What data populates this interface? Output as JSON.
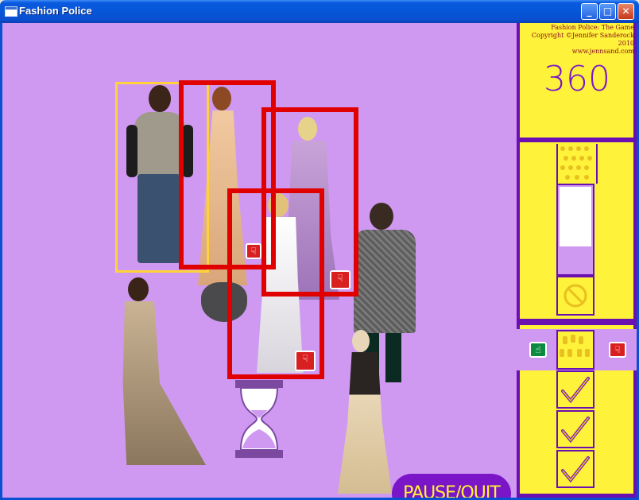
{
  "window": {
    "title": "Fashion Police",
    "icon": "window-app-icon",
    "buttons": {
      "minimize": "_",
      "maximize": "□",
      "close": "✕"
    }
  },
  "panel": {
    "credits": [
      "Fashion Police: The Game",
      "Copyright ©Jennifer Sanderock 2010",
      "www.jennsand.com"
    ],
    "score": "360",
    "queue_fill": 0.68,
    "row_rejected_icon": "no-symbol-icon",
    "approve_icon": "thumbs-up-icon",
    "reject_icon": "thumbs-down-icon",
    "checkmarks": 3
  },
  "game": {
    "pause_label": "PAUSE/QUIT",
    "hourglass_icon": "hourglass-icon",
    "colors": {
      "background": "#cf99f2",
      "panel_yellow": "#fff23a",
      "panel_purple": "#6a0fb0",
      "reject_box": "#e00000",
      "active_box": "#ffd23a"
    }
  }
}
